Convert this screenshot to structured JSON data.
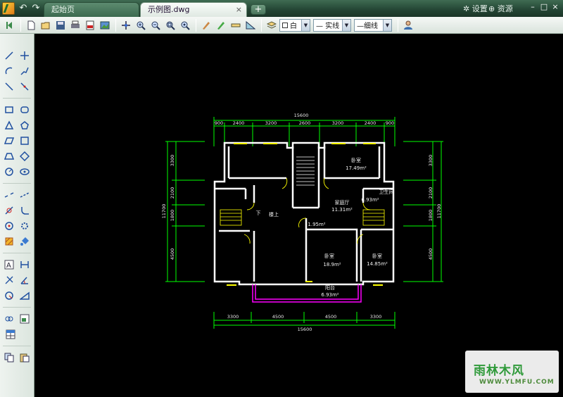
{
  "titlebar": {
    "tabs": [
      {
        "label": "起始页",
        "active": false
      },
      {
        "label": "示例图.dwg",
        "active": true
      }
    ],
    "new_tab_label": "+",
    "close_tab_label": "×",
    "settings_label": "设置",
    "resources_label": "资源",
    "min_label": "–",
    "max_label": "□",
    "close_label": "×"
  },
  "toolbar": {
    "color_value": "白",
    "linetype_value": "— 实线",
    "lineweight_value": "—细线"
  },
  "drawing": {
    "top_overall": "15600",
    "top_segments": [
      "900",
      "2400",
      "3200",
      "2600",
      "3200",
      "2400",
      "900"
    ],
    "bottom_segments": [
      "3300",
      "4500",
      "4500",
      "3300"
    ],
    "bottom_overall": "15600",
    "left_overall": "11700",
    "left_segments": [
      "3300",
      "2100",
      "1800",
      "4500"
    ],
    "right_overall": "11700",
    "right_segments": [
      "3300",
      "2100",
      "1800",
      "4500"
    ],
    "rooms": {
      "bedroom_top": "卧室",
      "bedroom_top_area": "17.49m²",
      "bathroom": "卫生间",
      "bathroom_area": "6.93m²",
      "living": "家庭厅",
      "living_area": "11.31m²",
      "stairs_down": "下",
      "stairs_up": "楼上",
      "small_area": "1.95m²",
      "bedroom_mid": "卧室",
      "bedroom_mid_area": "18.9m²",
      "bedroom_right": "卧室",
      "bedroom_right_area": "14.85m²",
      "balcony": "阳台",
      "balcony_area": "6.93m²"
    }
  },
  "watermark": {
    "brand": "雨林木风",
    "url": "WWW.YLMFU.COM"
  },
  "colors": {
    "wall": "#ffffff",
    "dimension": "#00ff00",
    "window": "#ffff00",
    "balcony_rail": "#ff00ff",
    "background": "#000000"
  }
}
